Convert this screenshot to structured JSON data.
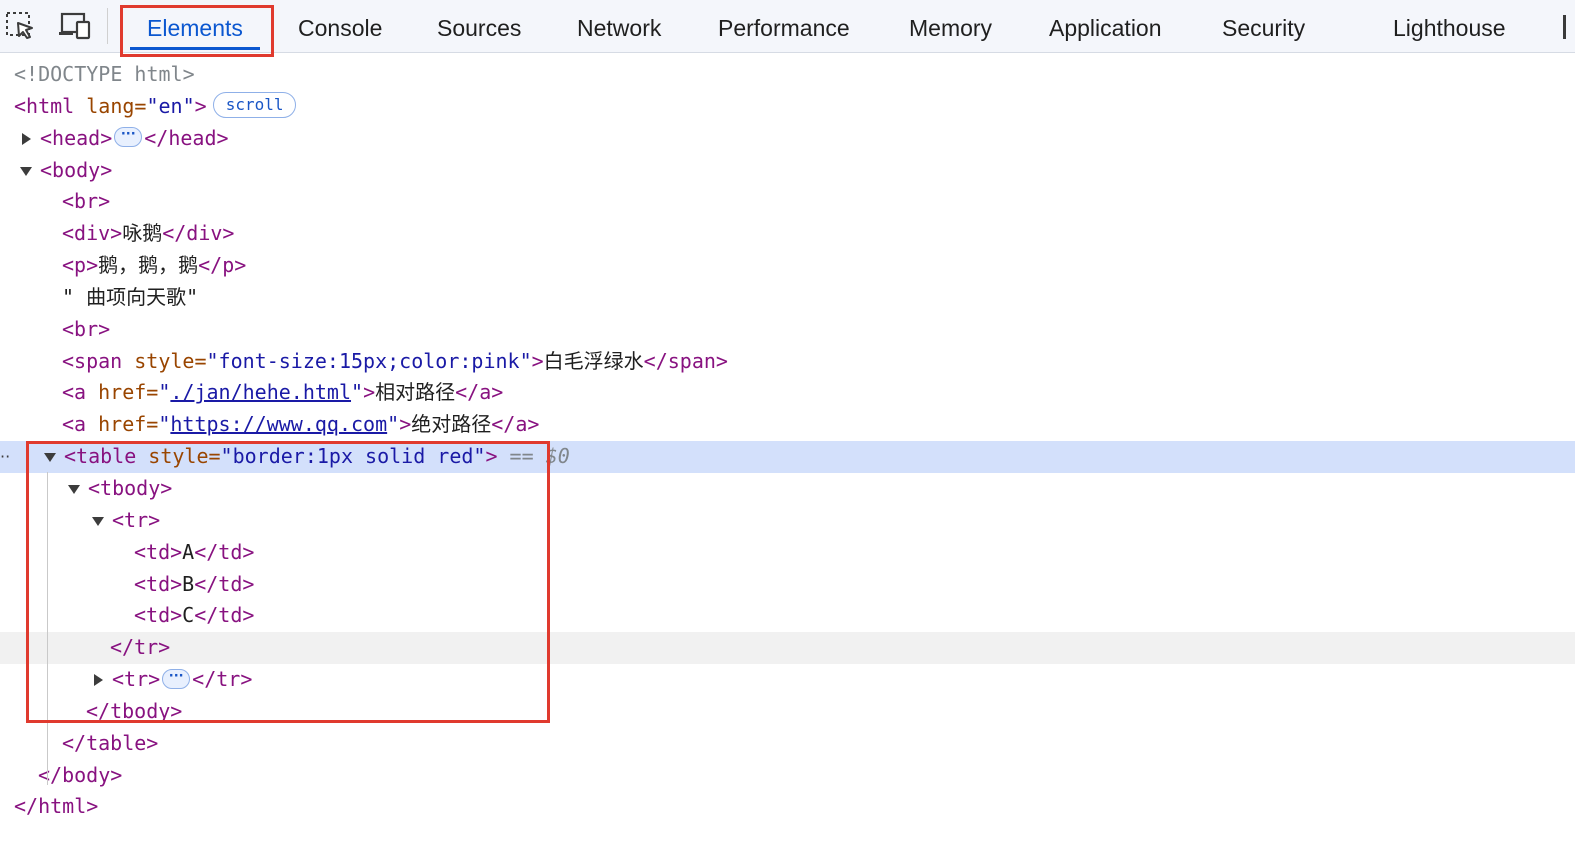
{
  "tabs": [
    {
      "label": "Elements",
      "active": true
    },
    {
      "label": "Console"
    },
    {
      "label": "Sources"
    },
    {
      "label": "Network"
    },
    {
      "label": "Performance"
    },
    {
      "label": "Memory"
    },
    {
      "label": "Application"
    },
    {
      "label": "Security"
    },
    {
      "label": "Lighthouse"
    }
  ],
  "toolbar": {
    "inspect_icon": "select-element-icon",
    "device_icon": "device-toolbar-icon"
  },
  "dom": {
    "doctype": "<!DOCTYPE html>",
    "html_open": "<html",
    "html_lang_attr": " lang=",
    "html_lang_val": "\"en\"",
    "html_close_bracket": ">",
    "scroll_badge": "scroll",
    "head_open": "<head>",
    "head_close": "</head>",
    "body_open": "<body>",
    "br": "<br>",
    "div_open": "<div>",
    "div_text": "咏鹅",
    "div_close": "</div>",
    "p_open": "<p>",
    "p_text": "鹅，鹅，鹅",
    "p_close": "</p>",
    "text_node": "\" 曲项向天歌\"",
    "span_open": "<span",
    "span_style_attr": " style=",
    "span_style_val": "\"font-size:15px;color:pink\"",
    "gt": ">",
    "span_text": "白毛浮绿水",
    "span_close": "</span>",
    "a_open": "<a",
    "a_href_attr": " href=",
    "quote": "\"",
    "a1_href": "./jan/hehe.html",
    "a1_text": "相对路径",
    "a_close": "</a>",
    "a2_href": "https://www.qq.com",
    "a2_text": "绝对路径",
    "table_open": "<table",
    "table_style_attr": " style=",
    "table_style_val": "\"border:1px solid red\"",
    "selected_marker": " == $0",
    "tbody_open": "<tbody>",
    "tr_open": "<tr>",
    "td_open": "<td>",
    "td_close": "</td>",
    "td_values": [
      "A",
      "B",
      "C"
    ],
    "tr_close": "</tr>",
    "tbody_close": "</tbody>",
    "table_close": "</table>",
    "body_close": "</body>",
    "html_close": "</html>",
    "ellipsis": "···",
    "row_dots": "··"
  },
  "colors": {
    "highlight_box": "#e03a2e",
    "tag": "#881280",
    "attr_name": "#994500",
    "attr_value": "#1a1aa6",
    "selected_row": "#d3e0fb",
    "active_tab": "#0b57d0"
  }
}
